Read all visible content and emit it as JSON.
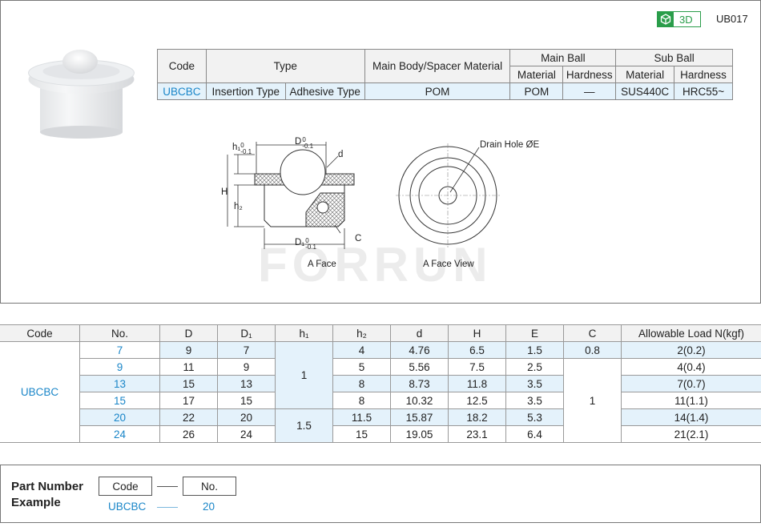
{
  "header": {
    "badge_label": "3D",
    "model_code": "UB017"
  },
  "type_table": {
    "h_code": "Code",
    "h_type": "Type",
    "h_body": "Main Body/Spacer Material",
    "h_main_ball": "Main Ball",
    "h_sub_ball": "Sub Ball",
    "h_material": "Material",
    "h_hardness": "Hardness",
    "row": {
      "code": "UBCBC",
      "type1": "Insertion Type",
      "type2": "Adhesive Type",
      "body": "POM",
      "main_mat": "POM",
      "main_hard": "—",
      "sub_mat": "SUS440C",
      "sub_hard": "HRC55~"
    }
  },
  "drawing": {
    "D": "D",
    "D_tol": "0",
    "D_tol2": "-0.1",
    "d": "d",
    "h1": "h₁",
    "h1_tol": "0",
    "h1_tol2": "-0.1",
    "H": "H",
    "h2": "h₂",
    "D1": "D₁",
    "D1_tol": "0",
    "D1_tol2": "-0.1",
    "C": "C",
    "a_face": "A Face",
    "drain_hole": "Drain Hole ØE",
    "a_face_view": "A Face View",
    "watermark": "FORRUN"
  },
  "spec_table": {
    "headers": [
      "Code",
      "No.",
      "D",
      "D₁",
      "h₁",
      "h₂",
      "d",
      "H",
      "E",
      "C",
      "Allowable Load N(kgf)"
    ],
    "code": "UBCBC",
    "rows": [
      {
        "no": "7",
        "D": "9",
        "D1": "7",
        "h2": "4",
        "d": "4.76",
        "H": "6.5",
        "E": "1.5",
        "load": "2(0.2)"
      },
      {
        "no": "9",
        "D": "11",
        "D1": "9",
        "h2": "5",
        "d": "5.56",
        "H": "7.5",
        "E": "2.5",
        "load": "4(0.4)"
      },
      {
        "no": "13",
        "D": "15",
        "D1": "13",
        "h2": "8",
        "d": "8.73",
        "H": "11.8",
        "E": "3.5",
        "load": "7(0.7)"
      },
      {
        "no": "15",
        "D": "17",
        "D1": "15",
        "h2": "8",
        "d": "10.32",
        "H": "12.5",
        "E": "3.5",
        "load": "11(1.1)"
      },
      {
        "no": "20",
        "D": "22",
        "D1": "20",
        "h2": "11.5",
        "d": "15.87",
        "H": "18.2",
        "E": "5.3",
        "load": "14(1.4)"
      },
      {
        "no": "24",
        "D": "26",
        "D1": "24",
        "h2": "15",
        "d": "19.05",
        "H": "23.1",
        "E": "6.4",
        "load": "21(2.1)"
      }
    ],
    "h1_a": "1",
    "h1_b": "1.5",
    "c_a": "0.8",
    "c_b": "1"
  },
  "example": {
    "title": "Part Number Example",
    "code_label": "Code",
    "no_label": "No.",
    "code_value": "UBCBC",
    "no_value": "20"
  }
}
